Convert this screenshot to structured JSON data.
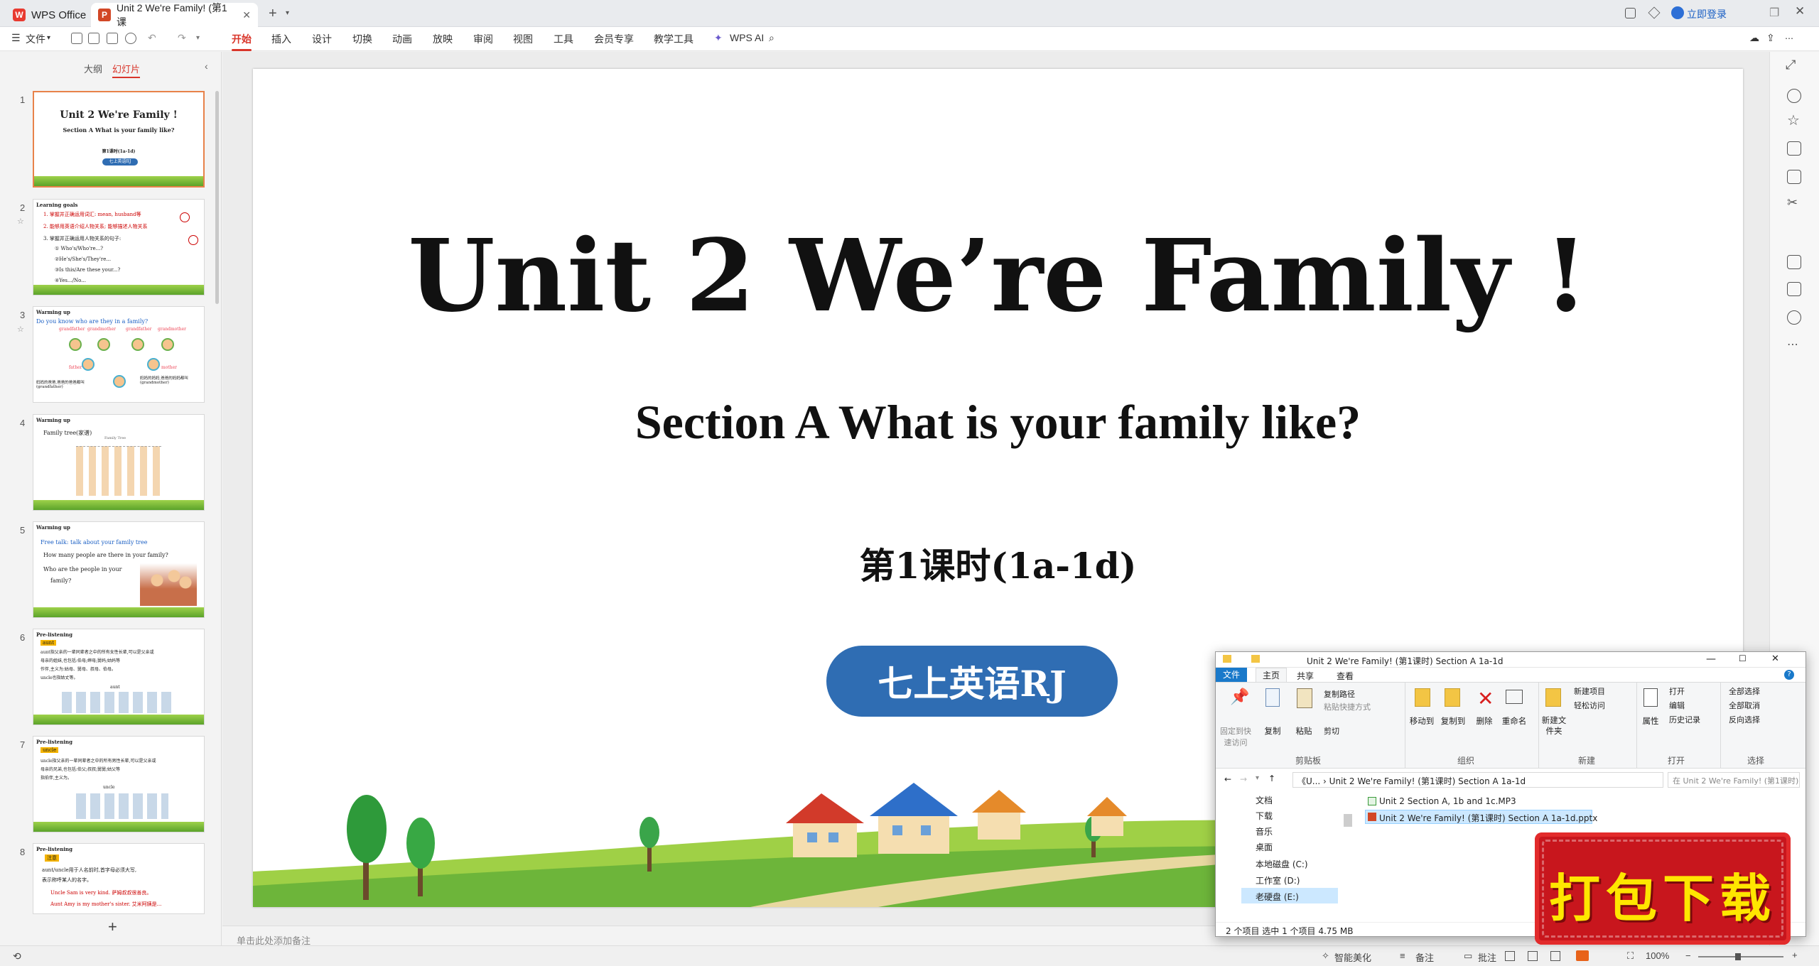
{
  "titlebar": {
    "app_tab": "WPS Office",
    "doc_tab": "Unit 2 We're Family! (第1课",
    "login": "立即登录"
  },
  "menu": {
    "file": "文件",
    "items": [
      "开始",
      "插入",
      "设计",
      "切换",
      "动画",
      "放映",
      "审阅",
      "视图",
      "工具",
      "会员专享",
      "教学工具"
    ],
    "wps_ai": "WPS AI"
  },
  "panel": {
    "tab_outline": "大纲",
    "tab_slides": "幻灯片"
  },
  "thumbs": [
    {
      "num": "1",
      "title": "Unit 2 We're Family !",
      "sub": "Section A What is your family like?",
      "lesson": "第1课时(1a-1d)",
      "badge": "七上英语RJ"
    },
    {
      "num": "2",
      "head": "Learning goals",
      "l1": "1. 掌握并正确运用词汇: mean, husband等",
      "l2": "2. 能够用英语介绍人物关系; 能够描述人物关系",
      "l3": "3. 掌握并正确运用人物关系的句子:",
      "l4": "① Who's/Who're...?",
      "l5": "②He's/She's/They're...",
      "l6": "③Is this/Are these your...?",
      "l7": "④Yes.../No..."
    },
    {
      "num": "3",
      "head": "Warming up",
      "q": "Do you know who are they in a family?",
      "n1": "grandfather",
      "n2": "grandmother",
      "n3": "grandfather",
      "n4": "grandmother",
      "f": "father",
      "m": "mother",
      "c1": "妈妈的爸爸,爸爸的爸爸都叫(grandfather)",
      "c2": "妈妈的妈妈,爸爸的妈妈都叫(grandmother)"
    },
    {
      "num": "4",
      "head": "Warming up",
      "t": "Family tree(家谱)",
      "s": "Family Tree"
    },
    {
      "num": "5",
      "head": "Warming up",
      "t": "Free talk: talk about your family tree",
      "b1": "How many people are there in your family?",
      "b2": "Who are the people in your",
      "b3": "family?"
    },
    {
      "num": "6",
      "head": "Pre-listening",
      "tag": "aunt",
      "l1": "aunt指父亲的一辈同辈者之中的所有女性长辈,可以是父亲或",
      "l2": "母亲的姐妹,也包括:伯母;婶母;舅妈;姑妈等",
      "l3": "作伴,主义为:姑母、舅母、叔母、伯母。",
      "l4": "uncle也指姑丈等。",
      "tree": "aunt"
    },
    {
      "num": "7",
      "head": "Pre-listening",
      "tag": "uncle",
      "l1": "uncle指父亲的一辈同辈者之中的所有男性长辈,可以是父亲或",
      "l2": "母亲的兄弟,也包括:伯父;叔叔;舅舅;姑父等",
      "l3": "指伯伴,主义为。",
      "tree": "uncle"
    },
    {
      "num": "8",
      "head": "Pre-listening",
      "tag": "注意",
      "l1": "aunt/uncle用于人名前时,首字母必须大写,",
      "l2": "表示称呼某人的名字。",
      "l3": "Uncle Sam is very kind. 萨姆叔叔很善良。",
      "l4": "Aunt Amy is my mother's sister. 艾米阿姨是..."
    }
  ],
  "slide": {
    "title": "Unit 2 We’re Family !",
    "subtitle": "Section A What is your family like?",
    "lesson": "第1课时(1a-1d)",
    "badge": "七上英语RJ"
  },
  "notes_placeholder": "单击此处添加备注",
  "explorer": {
    "title": "Unit 2 We're Family! (第1课时) Section A 1a-1d",
    "tabs": [
      "文件",
      "主页",
      "共享",
      "查看"
    ],
    "ribbon": {
      "pin": "固定到快速访问",
      "copy": "复制",
      "paste": "粘贴",
      "copy_path": "复制路径",
      "paste_shortcut": "粘贴快捷方式",
      "cut": "剪切",
      "move_to": "移动到",
      "copy_to": "复制到",
      "delete": "删除",
      "rename": "重命名",
      "new_folder": "新建文件夹",
      "new_item": "新建项目",
      "easy_access": "轻松访问",
      "properties": "属性",
      "open": "打开",
      "edit": "编辑",
      "history": "历史记录",
      "select_all": "全部选择",
      "select_none": "全部取消",
      "invert": "反向选择"
    },
    "groups": [
      "剪贴板",
      "组织",
      "新建",
      "打开",
      "选择"
    ],
    "path": "《U... › Unit 2 We're Family! (第1课时) Section A 1a-1d",
    "search_placeholder": "在 Unit 2 We're Family! (第1课时)...",
    "tree": [
      "文档",
      "下载",
      "音乐",
      "桌面",
      "本地磁盘 (C:)",
      "工作室 (D:)",
      "老硬盘 (E:)"
    ],
    "files": [
      "Unit  2 Section A, 1b and 1c.MP3",
      "Unit 2 We're Family! (第1课时) Section A 1a-1d.pptx"
    ],
    "status": "2 个项目     选中 1 个项目  4.75 MB"
  },
  "promo": "打包下载",
  "status": {
    "smart": "智能美化",
    "notes": "备注",
    "comment": "批注",
    "zoom": "100%"
  }
}
